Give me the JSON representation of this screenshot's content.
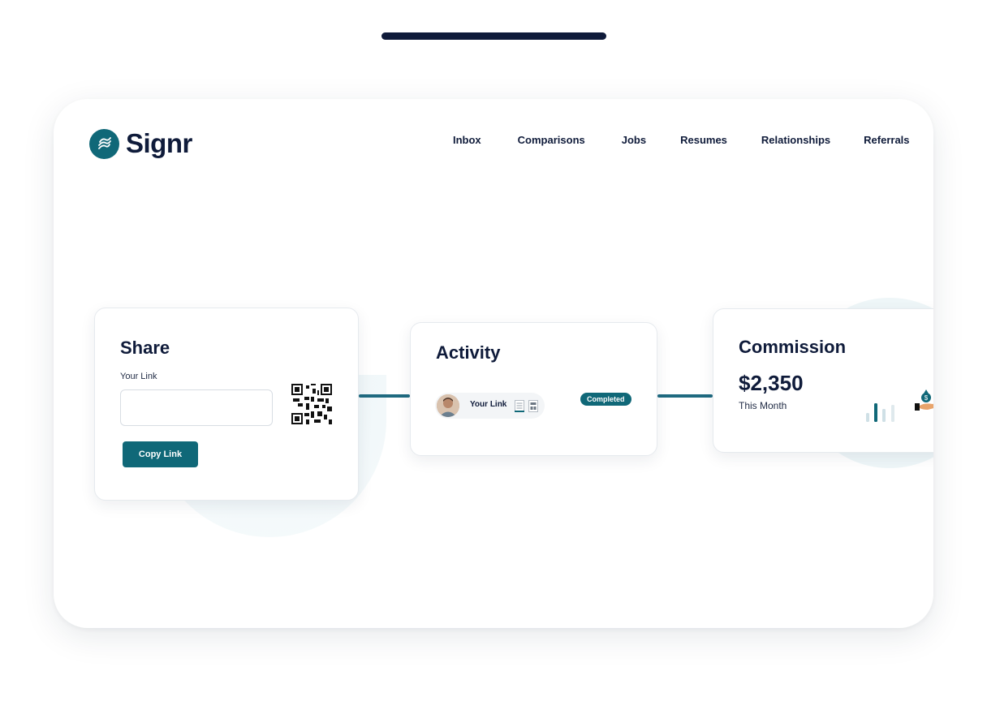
{
  "app": {
    "logo_text": "Signr",
    "logo_icon": "waves-logo-icon",
    "brand_color": "#106878"
  },
  "nav": {
    "items": [
      "Inbox",
      "Comparisons",
      "Jobs",
      "Resumes",
      "Relationships",
      "Referrals"
    ]
  },
  "share": {
    "title": "Share",
    "label": "Your Link",
    "input_value": "",
    "copy_button": "Copy Link",
    "qr_icon": "qr-code-icon"
  },
  "activity": {
    "title": "Activity",
    "row_label": "Your Link",
    "status": "Completed",
    "status_color": "#106878"
  },
  "commission": {
    "title": "Commission",
    "amount": "$2,350",
    "period": "This Month",
    "chart_icon": "bar-chart-icon",
    "money_icon": "money-bag-icon"
  }
}
